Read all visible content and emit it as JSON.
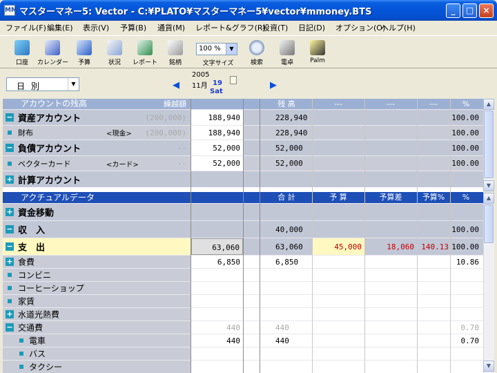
{
  "window": {
    "title": "マスターマネー5: Vector - C:¥PLATO¥マスターマネー5¥vector¥mmoney.BTS",
    "app_icon": "MM"
  },
  "menu": [
    "ファイル(F)",
    "編集(E)",
    "表示(V)",
    "予算(B)",
    "通貨(M)",
    "レポート&グラフ(R)",
    "投資(T)",
    "日記(D)",
    "オプション(O)",
    "ヘルプ(H)"
  ],
  "toolbar": [
    {
      "label": "口座",
      "icon": "account-icon",
      "color": "#3a9ad9"
    },
    {
      "label": "カレンダー",
      "icon": "calendar-icon",
      "color": "#3b5fc9"
    },
    {
      "label": "予算",
      "icon": "budget-arrow-icon",
      "color": "#2b62c9"
    },
    {
      "label": "状況",
      "icon": "status-icon",
      "color": "#8aa6d8"
    },
    {
      "label": "レポート",
      "icon": "report-icon",
      "color": "#2f8f4f"
    },
    {
      "label": "銘柄",
      "icon": "stocks-icon",
      "color": "#999999"
    },
    {
      "label": "文字サイズ",
      "icon": "font-size-icon",
      "color": "#ffffff"
    },
    {
      "label": "検索",
      "icon": "search-icon",
      "color": "#7f95bb"
    },
    {
      "label": "電卓",
      "icon": "calculator-icon",
      "color": "#777777"
    },
    {
      "label": "Palm",
      "icon": "palm-icon",
      "color": "#d6c22a"
    }
  ],
  "zoom": {
    "value": "100 %"
  },
  "period": {
    "value": "日別"
  },
  "date": {
    "year": "2005",
    "month": "11月",
    "day": "19",
    "weekday": "Sat"
  },
  "accounts_header": {
    "title": "アカウントの残高",
    "carry": "繰越額",
    "balance": "残 高",
    "c1": "---",
    "c2": "---",
    "c3": "---",
    "pct": "%"
  },
  "accounts": [
    {
      "type": "group",
      "label": "資産アカウント",
      "carry": "(200,000)",
      "day": "188,940",
      "balance": "228,940",
      "pct": "100.00"
    },
    {
      "type": "item",
      "label": "財布",
      "tag": "<現金>",
      "carry": "(200,000)",
      "day": "188,940",
      "balance": "228,940",
      "pct": "100.00"
    },
    {
      "type": "group",
      "label": "負債アカウント",
      "carry": "--",
      "day": "52,000",
      "balance": "52,000",
      "pct": "100.00"
    },
    {
      "type": "item",
      "label": "ベクターカード",
      "tag": "<カード>",
      "carry": "--",
      "day": "52,000",
      "balance": "52,000",
      "pct": "100.00"
    },
    {
      "type": "group-plus",
      "label": "計算アカウント",
      "carry": "",
      "day": "",
      "balance": "",
      "pct": ""
    }
  ],
  "actual_header": {
    "title": "アクチュアルデータ",
    "total": "合 計",
    "budget": "予 算",
    "diff": "予算差",
    "budget_pct": "予算%",
    "pct": "%"
  },
  "actual": [
    {
      "label": "資金移動",
      "toggle": "+",
      "style": "grp",
      "day": "",
      "total": "",
      "budget": "",
      "diff": "",
      "bpct": "",
      "pct": ""
    },
    {
      "label": "収　入",
      "toggle": "-",
      "style": "grp",
      "day": "",
      "total": "40,000",
      "budget": "",
      "diff": "",
      "bpct": "",
      "pct": "100.00"
    },
    {
      "label": "支　出",
      "toggle": "-",
      "style": "grp-hl",
      "day": "63,060",
      "total": "63,060",
      "budget": "45,000",
      "diff": "18,060",
      "bpct": "140.13",
      "pct": "100.00"
    },
    {
      "label": "食費",
      "toggle": "+",
      "style": "cat",
      "day": "6,850",
      "total": "6,850",
      "budget": "",
      "diff": "",
      "bpct": "",
      "pct": "10.86"
    },
    {
      "label": "コンビニ",
      "toggle": "dot",
      "style": "cat",
      "day": "",
      "total": "",
      "budget": "",
      "diff": "",
      "bpct": "",
      "pct": ""
    },
    {
      "label": "コーヒーショップ",
      "toggle": "dot",
      "style": "cat",
      "day": "",
      "total": "",
      "budget": "",
      "diff": "",
      "bpct": "",
      "pct": ""
    },
    {
      "label": "家賃",
      "toggle": "dot",
      "style": "cat",
      "day": "",
      "total": "",
      "budget": "",
      "diff": "",
      "bpct": "",
      "pct": ""
    },
    {
      "label": "水道光熱費",
      "toggle": "+",
      "style": "cat",
      "day": "",
      "total": "",
      "budget": "",
      "diff": "",
      "bpct": "",
      "pct": ""
    },
    {
      "label": "交通費",
      "toggle": "-",
      "style": "cat-dim",
      "day": "440",
      "total": "440",
      "budget": "",
      "diff": "",
      "bpct": "",
      "pct": "0.70"
    },
    {
      "label": "電車",
      "toggle": "subdot",
      "style": "cat",
      "day": "440",
      "total": "440",
      "budget": "",
      "diff": "",
      "bpct": "",
      "pct": "0.70"
    },
    {
      "label": "バス",
      "toggle": "subdot",
      "style": "cat",
      "day": "",
      "total": "",
      "budget": "",
      "diff": "",
      "bpct": "",
      "pct": ""
    },
    {
      "label": "タクシー",
      "toggle": "subdot",
      "style": "cat",
      "day": "",
      "total": "",
      "budget": "",
      "diff": "",
      "bpct": "",
      "pct": ""
    }
  ],
  "colors": {
    "title_bar": "#0454d8",
    "header_light": "#9cb0d4",
    "header_dark": "#1d4fb7",
    "highlight": "#fff8c0",
    "negative": "#c00000"
  }
}
